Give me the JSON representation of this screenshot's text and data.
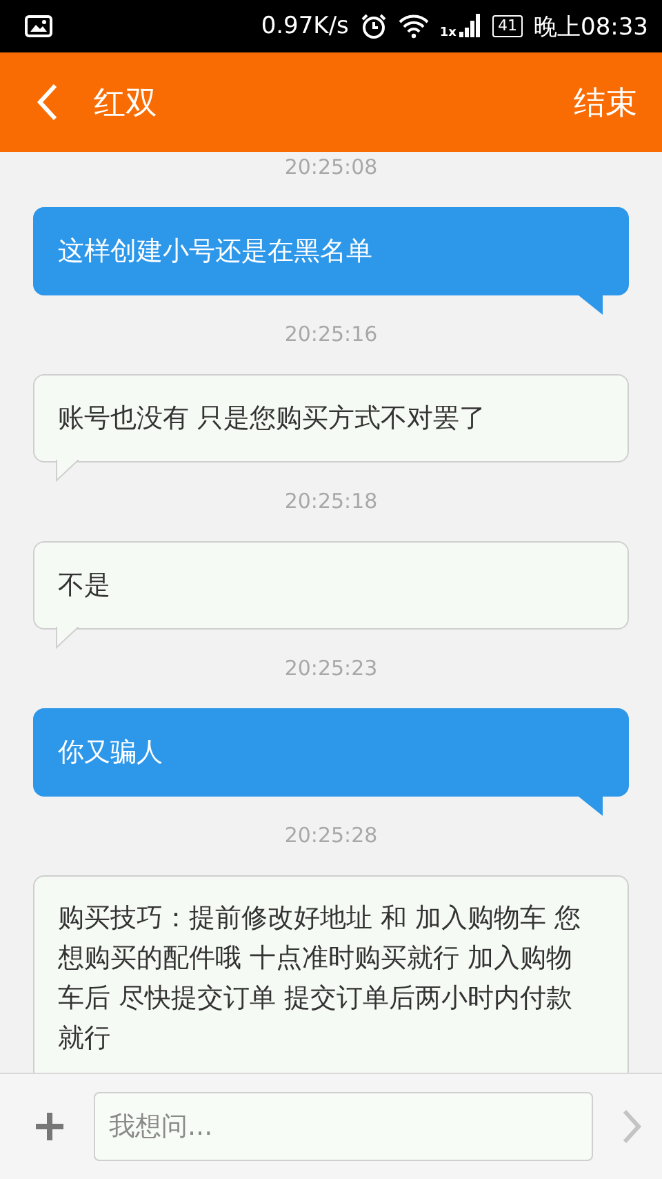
{
  "status_bar": {
    "speed": "0.97K/s",
    "network": "1x",
    "battery": "41",
    "time": "晚上08:33"
  },
  "header": {
    "title": "红双",
    "action": "结束"
  },
  "messages": [
    {
      "kind": "timestamp",
      "text": "20:25:08"
    },
    {
      "kind": "sent",
      "text": "这样创建小号还是在黑名单"
    },
    {
      "kind": "timestamp",
      "text": "20:25:16"
    },
    {
      "kind": "received",
      "text": "账号也没有 只是您购买方式不对罢了"
    },
    {
      "kind": "timestamp",
      "text": "20:25:18"
    },
    {
      "kind": "received",
      "text": "不是"
    },
    {
      "kind": "timestamp",
      "text": "20:25:23"
    },
    {
      "kind": "sent",
      "text": "你又骗人"
    },
    {
      "kind": "timestamp",
      "text": "20:25:28"
    },
    {
      "kind": "received",
      "text": "购买技巧：提前修改好地址 和 加入购物车 您想购买的配件哦 十点准时购买就行 加入购物车后 尽快提交订单 提交订单后两小时内付款就行"
    }
  ],
  "composer": {
    "placeholder": "我想问..."
  }
}
